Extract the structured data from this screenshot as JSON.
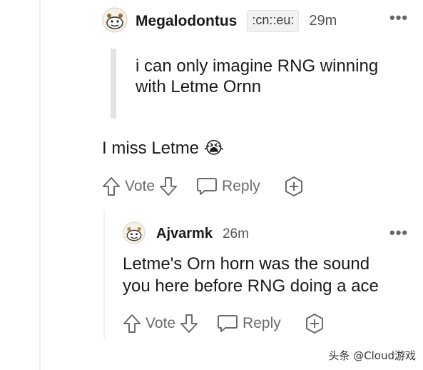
{
  "comment1": {
    "username": "Megalodontus",
    "flair": ":cn::eu:",
    "time": "29m",
    "more": "•••",
    "quote": "i can only imagine RNG winning with Letme Ornn",
    "body": "I miss Letme",
    "emoji": "😭",
    "actions": {
      "vote_label": "Vote",
      "reply_label": "Reply"
    }
  },
  "comment2": {
    "username": "Ajvarmk",
    "time": "26m",
    "more": "•••",
    "body_line1": "Letme's Orn horn was the sound",
    "body_line2": "you here before RNG doing a ace",
    "actions": {
      "vote_label": "Vote",
      "reply_label": "Reply"
    }
  },
  "watermark": "头条 @Cloud游戏",
  "colors": {
    "text": "#1a1a1b",
    "muted": "#6b6b6b",
    "thread": "#edeff1"
  }
}
